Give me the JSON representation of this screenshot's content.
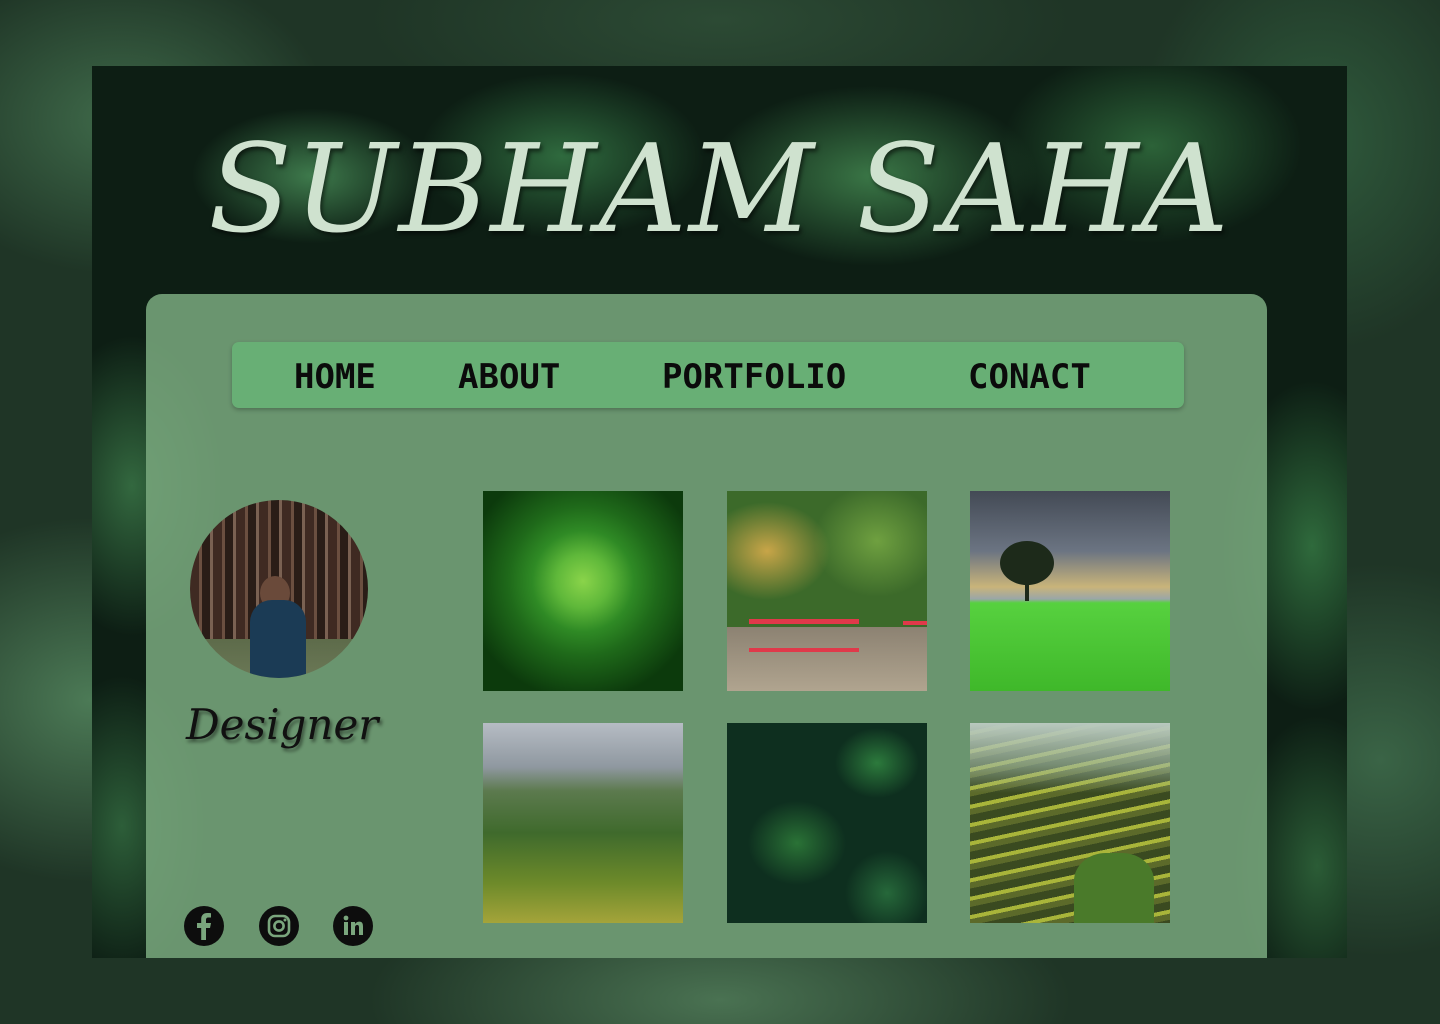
{
  "site": {
    "title": "SUBHAM SAHA",
    "role": "Designer"
  },
  "nav": {
    "items": [
      "HOME",
      "ABOUT",
      "PORTFOLIO",
      "CONACT"
    ]
  },
  "social": {
    "facebook": "facebook-icon",
    "instagram": "instagram-icon",
    "linkedin": "linkedin-icon"
  },
  "gallery": {
    "images": [
      "green-fern-plant-photo",
      "red-bridge-forest-photo",
      "tree-in-rice-field-photo",
      "mountain-valley-photo",
      "dark-green-foliage-photo",
      "rice-terraces-photo"
    ]
  },
  "colors": {
    "nav_bg": "#68af75",
    "card_bg": "#78a67c",
    "title": "#cfe2cf"
  }
}
